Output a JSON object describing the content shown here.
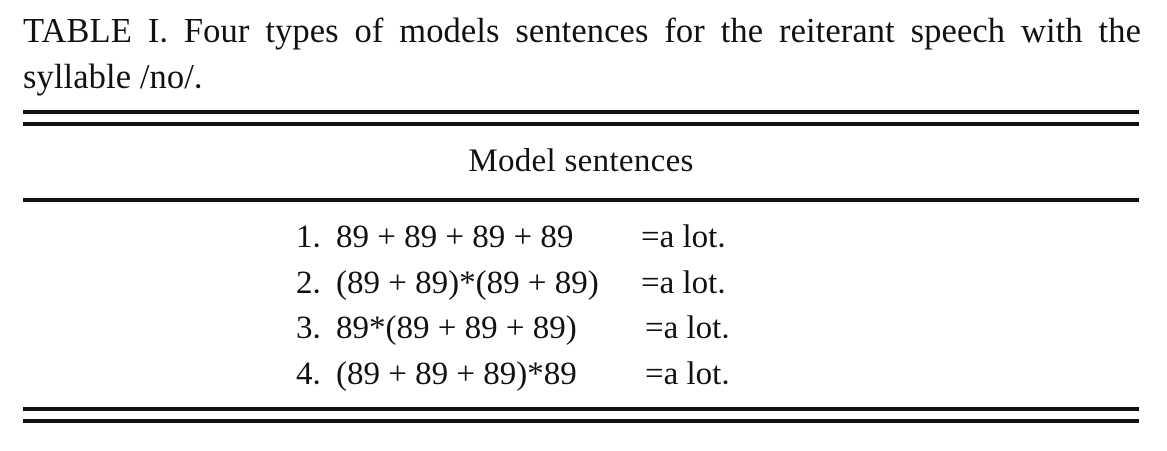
{
  "caption": "TABLE I. Four types of models sentences for the reiterant speech with the syllable /no/.",
  "table": {
    "header": "Model sentences",
    "rows": [
      {
        "number": "1.",
        "expression": "89 + 89 + 89 + 89",
        "result": "=a lot."
      },
      {
        "number": "2.",
        "expression": "(89 + 89)*(89 + 89)",
        "result": "=a lot."
      },
      {
        "number": "3.",
        "expression": "89*(89 + 89 + 89)",
        "result": "=a lot."
      },
      {
        "number": "4.",
        "expression": "(89 + 89 + 89)*89",
        "result": "=a lot."
      }
    ]
  }
}
